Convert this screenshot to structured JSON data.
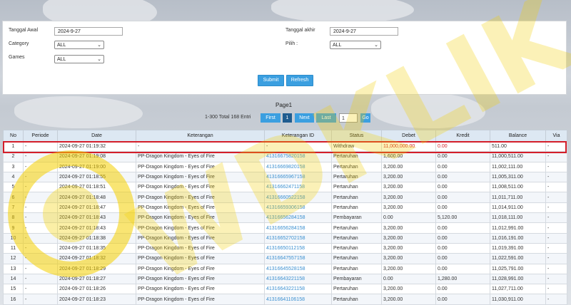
{
  "filters": {
    "tanggal_awal_label": "Tanggal Awal",
    "tanggal_awal_value": "2024-9-27",
    "tanggal_akhir_label": "Tanggal akhir",
    "tanggal_akhir_value": "2024-9-27",
    "category_label": "Category",
    "category_value": "ALL",
    "pilih_label": "Pilih  :",
    "pilih_value": "ALL",
    "games_label": "Games",
    "games_value": "ALL",
    "submit_label": "Submit",
    "refresh_label": "Refresh"
  },
  "pagination": {
    "title": "Page1",
    "info": "1-300 Total 168 Entri",
    "first": "First",
    "current": "1",
    "next": "Next",
    "last": "Last",
    "page_input": "1",
    "go": "Go"
  },
  "table": {
    "headers": [
      "No",
      "Periode",
      "Date",
      "Keterangan",
      "Keterangan ID",
      "Status",
      "Debet",
      "Kredit",
      "Balance",
      "Via"
    ],
    "rows": [
      [
        "1",
        "-",
        "2024-09-27 01:19:32",
        "-",
        "-",
        "Withdraw",
        "11,000,000.00",
        "0.00",
        "511.00",
        "-"
      ],
      [
        "2",
        "-",
        "2024-09-27 01:19:08",
        "PP-Dragon Kingdom - Eyes of Fire",
        "41316675820158",
        "Pertaruhan",
        "1,600.00",
        "0.00",
        "11,000,511.00",
        "-"
      ],
      [
        "3",
        "-",
        "2024-09-27 01:19:00",
        "PP-Dragon Kingdom - Eyes of Fire",
        "41316669820158",
        "Pertaruhan",
        "3,200.00",
        "0.00",
        "11,002,111.00",
        "-"
      ],
      [
        "4",
        "-",
        "2024-09-27 01:18:55",
        "PP-Dragon Kingdom - Eyes of Fire",
        "41316665967158",
        "Pertaruhan",
        "3,200.00",
        "0.00",
        "11,005,311.00",
        "-"
      ],
      [
        "5",
        "-",
        "2024-09-27 01:18:51",
        "PP-Dragon Kingdom - Eyes of Fire",
        "41316662471158",
        "Pertaruhan",
        "3,200.00",
        "0.00",
        "11,008,511.00",
        "-"
      ],
      [
        "6",
        "-",
        "2024-09-27 01:18:48",
        "PP-Dragon Kingdom - Eyes of Fire",
        "41316660522158",
        "Pertaruhan",
        "3,200.00",
        "0.00",
        "11,011,711.00",
        "-"
      ],
      [
        "7",
        "-",
        "2024-09-27 01:18:47",
        "PP-Dragon Kingdom - Eyes of Fire",
        "41316659306158",
        "Pertaruhan",
        "3,200.00",
        "0.00",
        "11,014,911.00",
        "-"
      ],
      [
        "8",
        "-",
        "2024-09-27 01:18:43",
        "PP-Dragon Kingdom - Eyes of Fire",
        "41316656284158",
        "Pembayaran",
        "0.00",
        "5,120.00",
        "11,018,111.00",
        "-"
      ],
      [
        "9",
        "-",
        "2024-09-27 01:18:43",
        "PP-Dragon Kingdom - Eyes of Fire",
        "41316656284158",
        "Pertaruhan",
        "3,200.00",
        "0.00",
        "11,012,991.00",
        "-"
      ],
      [
        "10",
        "-",
        "2024-09-27 01:18:38",
        "PP-Dragon Kingdom - Eyes of Fire",
        "41316652702158",
        "Pertaruhan",
        "3,200.00",
        "0.00",
        "11,016,191.00",
        "-"
      ],
      [
        "11",
        "-",
        "2024-09-27 01:18:35",
        "PP-Dragon Kingdom - Eyes of Fire",
        "41316650112158",
        "Pertaruhan",
        "3,200.00",
        "0.00",
        "11,019,391.00",
        "-"
      ],
      [
        "12",
        "-",
        "2024-09-27 01:18:32",
        "PP-Dragon Kingdom - Eyes of Fire",
        "41316647557158",
        "Pertaruhan",
        "3,200.00",
        "0.00",
        "11,022,591.00",
        "-"
      ],
      [
        "13",
        "-",
        "2024-09-27 01:18:29",
        "PP-Dragon Kingdom - Eyes of Fire",
        "41316645528158",
        "Pertaruhan",
        "3,200.00",
        "0.00",
        "11,025,791.00",
        "-"
      ],
      [
        "14",
        "-",
        "2024-09-27 01:18:27",
        "PP-Dragon Kingdom - Eyes of Fire",
        "41316643221158",
        "Pembayaran",
        "0.00",
        "1,280.00",
        "11,028,991.00",
        "-"
      ],
      [
        "15",
        "-",
        "2024-09-27 01:18:26",
        "PP-Dragon Kingdom - Eyes of Fire",
        "41316643221158",
        "Pertaruhan",
        "3,200.00",
        "0.00",
        "11,027,711.00",
        "-"
      ],
      [
        "16",
        "-",
        "2024-09-27 01:18:23",
        "PP-Dragon Kingdom - Eyes of Fire",
        "41316641106158",
        "Pertaruhan",
        "3,200.00",
        "0.00",
        "11,030,911.00",
        "-"
      ]
    ]
  },
  "watermark_text": "WDKLIK",
  "colors": {
    "accent": "#3b9fe0",
    "highlight": "#d41e2a",
    "link": "#3a8fd0",
    "header_bg": "#dde8f3"
  }
}
